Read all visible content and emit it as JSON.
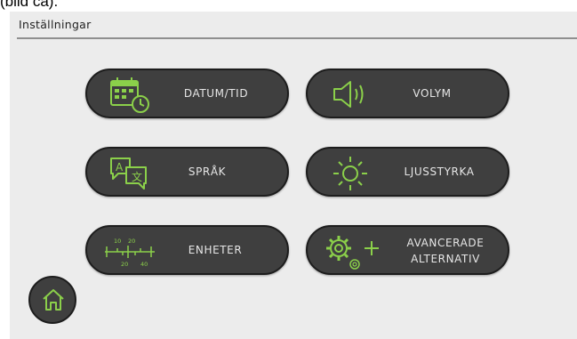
{
  "caption": "(bild ca).",
  "header": {
    "title": "Inställningar"
  },
  "tiles": [
    {
      "label": "DATUM/TID",
      "icon": "calendar-clock-icon"
    },
    {
      "label": "VOLYM",
      "icon": "speaker-icon"
    },
    {
      "label": "SPRÅK",
      "icon": "translate-icon"
    },
    {
      "label": "LJUSSTYRKA",
      "icon": "sun-icon"
    },
    {
      "label": "ENHETER",
      "icon": "ruler-units-icon"
    },
    {
      "label": "AVANCERADE",
      "label2": "ALTERNATIV",
      "icon": "gears-plus-icon"
    }
  ],
  "ruler": {
    "top1": "10",
    "top2": "20",
    "bottom1": "20",
    "bottom2": "40"
  },
  "home": {
    "icon": "home-icon"
  },
  "colors": {
    "accent": "#8bd04a",
    "tile": "#3f3f3f",
    "background": "#ececec"
  }
}
